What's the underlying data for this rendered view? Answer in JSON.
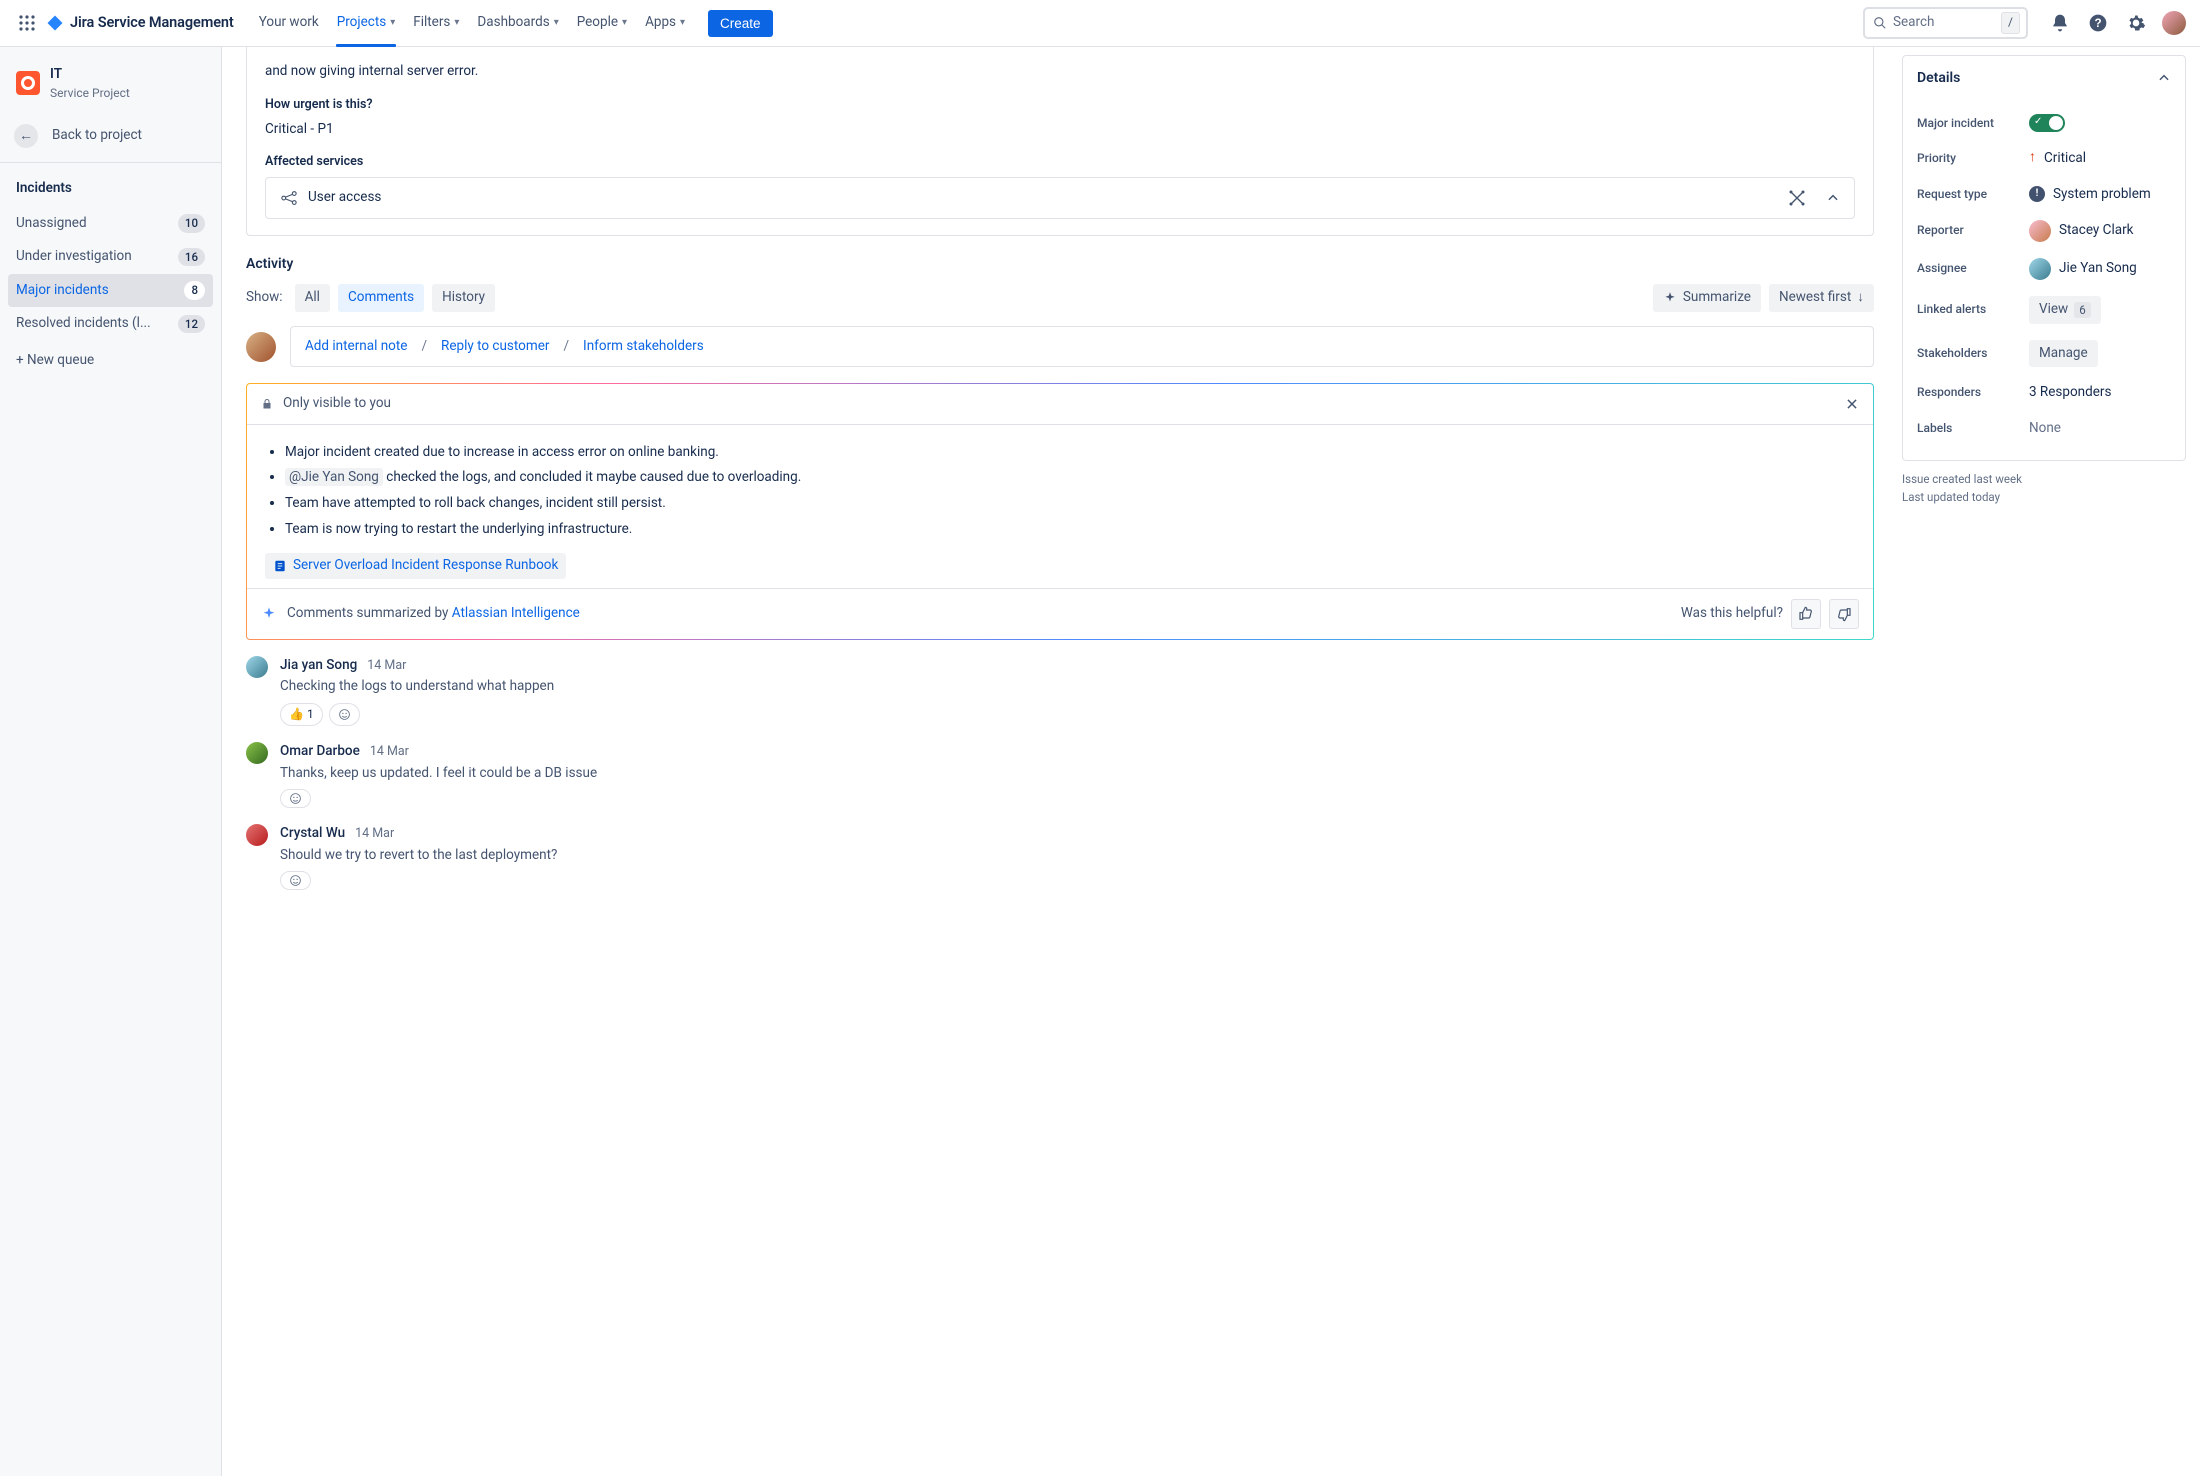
{
  "nav": {
    "brand": "Jira Service Management",
    "items": [
      "Your work",
      "Projects",
      "Filters",
      "Dashboards",
      "People",
      "Apps"
    ],
    "create": "Create",
    "search_placeholder": "Search",
    "search_kbd": "/"
  },
  "sidebar": {
    "project_name": "IT",
    "project_sub": "Service Project",
    "back": "Back to project",
    "heading": "Incidents",
    "queues": [
      {
        "label": "Unassigned",
        "count": "10"
      },
      {
        "label": "Under investigation",
        "count": "16"
      },
      {
        "label": "Major incidents",
        "count": "8"
      },
      {
        "label": "Resolved incidents (l...",
        "count": "12"
      }
    ],
    "new_queue": "+ New queue"
  },
  "issue": {
    "desc_tail": "and now giving internal server error.",
    "urgent_label": "How urgent is this?",
    "urgent_value": "Critical - P1",
    "affected_label": "Affected services",
    "affected_value": "User access"
  },
  "activity": {
    "heading": "Activity",
    "show_label": "Show:",
    "tabs": [
      "All",
      "Comments",
      "History"
    ],
    "summarize": "Summarize",
    "sort": "Newest first",
    "reply": {
      "add_note": "Add internal note",
      "reply_customer": "Reply to customer",
      "inform": "Inform stakeholders"
    },
    "ai": {
      "visibility": "Only visible to you",
      "bullets": [
        "Major incident created due to increase in access error on online banking.",
        "@Jie Yan Song  checked the logs, and concluded it maybe caused due to overloading.",
        "Team have attempted to roll back changes, incident still persist.",
        "Team is now trying to restart the underlying infrastructure."
      ],
      "mention": "@Jie Yan Song",
      "bullet2_tail": "checked the logs, and concluded it maybe caused due to overloading.",
      "doc": "Server Overload Incident Response Runbook",
      "summary_by_prefix": "Comments summarized by ",
      "summary_by_link": "Atlassian Intelligence",
      "helpful": "Was this helpful?"
    },
    "comments": [
      {
        "name": "Jia yan Song",
        "date": "14 Mar",
        "body": "Checking the logs to understand what happen",
        "react": "👍",
        "react_count": "1"
      },
      {
        "name": "Omar Darboe",
        "date": "14 Mar",
        "body": "Thanks, keep us updated. I feel it could be a DB issue"
      },
      {
        "name": "Crystal Wu",
        "date": "14 Mar",
        "body": "Should we try to revert to the last deployment?"
      }
    ]
  },
  "details": {
    "heading": "Details",
    "fields": {
      "major_incident_label": "Major incident",
      "priority_label": "Priority",
      "priority_value": "Critical",
      "request_type_label": "Request type",
      "request_type_value": "System problem",
      "reporter_label": "Reporter",
      "reporter_value": "Stacey Clark",
      "assignee_label": "Assignee",
      "assignee_value": "Jie Yan Song",
      "linked_alerts_label": "Linked alerts",
      "linked_alerts_value": "View",
      "linked_alerts_count": "6",
      "stakeholders_label": "Stakeholders",
      "stakeholders_value": "Manage",
      "responders_label": "Responders",
      "responders_value": "3 Responders",
      "labels_label": "Labels",
      "labels_value": "None"
    },
    "meta": {
      "created": "Issue created last week",
      "updated": "Last updated today"
    }
  }
}
